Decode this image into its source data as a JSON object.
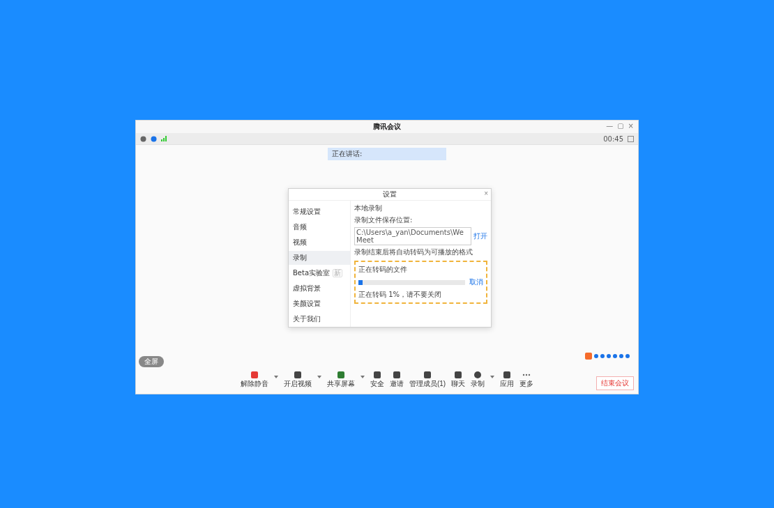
{
  "window": {
    "title": "腾讯会议",
    "controls": [
      "—",
      "▢",
      "×"
    ]
  },
  "top_bar": {
    "meeting_time": "00:45",
    "speaking": "正在讲话:"
  },
  "dialog": {
    "title": "设置",
    "close": "×",
    "sidebar": [
      {
        "label": "常规设置",
        "selected": false
      },
      {
        "label": "音频",
        "selected": false
      },
      {
        "label": "视频",
        "selected": false
      },
      {
        "label": "录制",
        "selected": true
      },
      {
        "label": "Beta实验室",
        "selected": false,
        "badge": "新"
      },
      {
        "label": "虚拟背景",
        "selected": false
      },
      {
        "label": "美颜设置",
        "selected": false
      },
      {
        "label": "关于我们",
        "selected": false
      }
    ],
    "section_title": "本地录制",
    "path_label": "录制文件保存位置:",
    "path_value": "C:\\Users\\a_yan\\Documents\\WeMeet",
    "open_link": "打开",
    "hint": "录制结束后将自动转码为可播放的格式",
    "transcode": {
      "title": "正在转码的文件",
      "level": 0.04,
      "action": "取消",
      "status": "正在转码 1%，请不要关闭"
    }
  },
  "fullscreen_button": "全屏",
  "toolbar": [
    {
      "label": "解除静音",
      "caret": true
    },
    {
      "label": "开启视频",
      "caret": true
    },
    {
      "label": "共享屏幕",
      "caret": true
    },
    {
      "label": "安全",
      "caret": false
    },
    {
      "label": "邀请",
      "caret": false
    },
    {
      "label": "管理成员(1)",
      "caret": false
    },
    {
      "label": "聊天",
      "caret": false
    },
    {
      "label": "录制",
      "caret": true
    },
    {
      "label": "应用",
      "caret": false
    },
    {
      "label": "更多",
      "caret": false
    }
  ],
  "end_button": "结束会议"
}
